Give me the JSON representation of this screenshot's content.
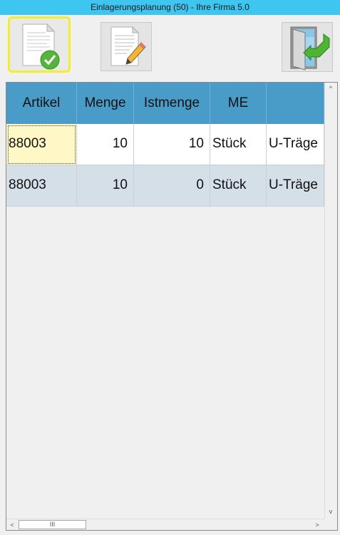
{
  "window": {
    "title": "Einlagerungsplanung (50) - Ihre Firma 5.0"
  },
  "toolbar": {
    "buttons": [
      {
        "name": "confirm-document-button",
        "icon": "document-check-icon",
        "selected": true
      },
      {
        "name": "edit-document-button",
        "icon": "document-pencil-icon",
        "selected": false
      },
      {
        "name": "exit-button",
        "icon": "exit-door-icon",
        "selected": false
      }
    ],
    "highlight_color": "#f2ef2a"
  },
  "grid": {
    "columns": [
      "Artikel",
      "Menge",
      "Istmenge",
      "ME",
      ""
    ],
    "rows": [
      {
        "artikel": "88003",
        "menge": "10",
        "istmenge": "10",
        "me": "Stück",
        "bez": "U-Träge"
      },
      {
        "artikel": "88003",
        "menge": "10",
        "istmenge": "0",
        "me": "Stück",
        "bez": "U-Träge"
      }
    ],
    "header_color": "#4a9cc8",
    "alt_row_color": "#d5dfe8",
    "focus_cell_color": "#fff8c6"
  },
  "scrollbars": {
    "up": "^",
    "down": "v",
    "left": "<",
    "right": ">",
    "thumb_grip": "III"
  }
}
